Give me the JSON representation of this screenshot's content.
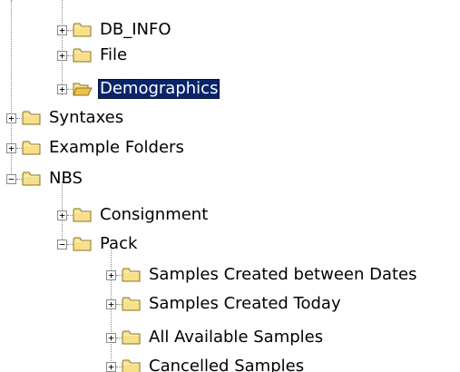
{
  "colors": {
    "selection_bg": "#0a246a",
    "selection_text": "#ffffff",
    "folder_fill": "#f7e08a",
    "folder_stroke": "#8a7320",
    "tree_line": "#8a8a8a"
  },
  "tree": {
    "nodes": [
      {
        "label": "DB_INFO",
        "expander": "+",
        "icon": "folder-closed-icon",
        "selected": false
      },
      {
        "label": "File",
        "expander": "+",
        "icon": "folder-closed-icon",
        "selected": false
      },
      {
        "label": "Demographics",
        "expander": "+",
        "icon": "folder-open-icon",
        "selected": true
      },
      {
        "label": "Syntaxes",
        "expander": "+",
        "icon": "folder-closed-icon",
        "selected": false
      },
      {
        "label": "Example Folders",
        "expander": "+",
        "icon": "folder-closed-icon",
        "selected": false
      },
      {
        "label": "NBS",
        "expander": "−",
        "icon": "folder-closed-icon",
        "selected": false
      },
      {
        "label": "Consignment",
        "expander": "+",
        "icon": "folder-closed-icon",
        "selected": false
      },
      {
        "label": "Pack",
        "expander": "−",
        "icon": "folder-closed-icon",
        "selected": false
      },
      {
        "label": "Samples Created between Dates",
        "expander": "+",
        "icon": "folder-closed-icon",
        "selected": false
      },
      {
        "label": "Samples Created Today",
        "expander": "+",
        "icon": "folder-closed-icon",
        "selected": false
      },
      {
        "label": "All Available Samples",
        "expander": "+",
        "icon": "folder-closed-icon",
        "selected": false
      },
      {
        "label": "Cancelled Samples",
        "expander": "+",
        "icon": "folder-closed-icon",
        "selected": false
      }
    ]
  }
}
